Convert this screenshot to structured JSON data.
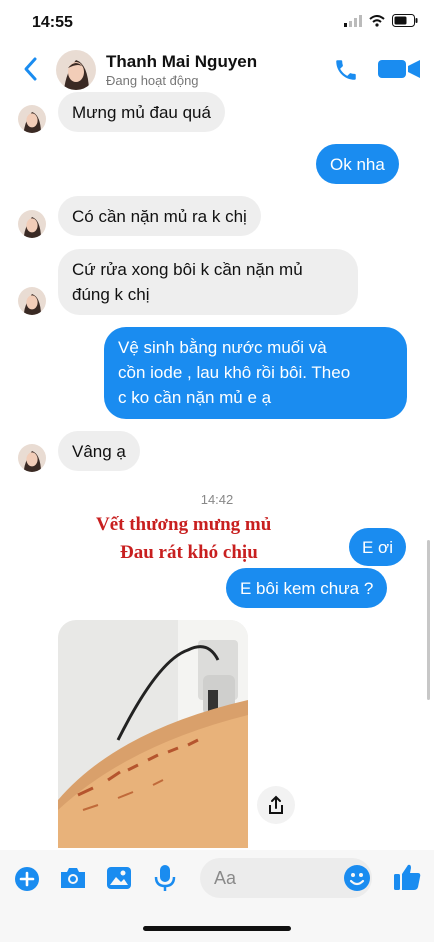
{
  "status_bar": {
    "time": "14:55"
  },
  "header": {
    "contact_name": "Thanh Mai Nguyen",
    "presence": "Đang hoạt động",
    "back_icon": "chevron-left-icon",
    "call_icon": "phone-icon",
    "video_icon": "video-camera-icon"
  },
  "messages": [
    {
      "from": "contact",
      "text": "Mưng mủ đau quá"
    },
    {
      "from": "me",
      "text": "Ok nha"
    },
    {
      "from": "contact",
      "text": "Có cần nặn mủ ra k chị"
    },
    {
      "from": "contact",
      "lines": [
        "Cứ rửa xong bôi k cần nặn mủ",
        "đúng k chị"
      ]
    },
    {
      "from": "me",
      "lines": [
        "Vệ sinh bằng nước muối và",
        "cồn iode , lau khô rồi bôi. Theo",
        "c ko cần nặn mủ e ạ"
      ]
    },
    {
      "from": "contact",
      "text": "Vâng ạ"
    },
    {
      "from": "me",
      "text": "E ơi"
    },
    {
      "from": "me",
      "text": "E bôi kem chưa ?"
    }
  ],
  "time_separator": "14:42",
  "overlay_caption": {
    "line1": "Vết thương mưng mủ",
    "line2": "Đau rát khó chịu"
  },
  "composer": {
    "placeholder": "Aa",
    "icons": [
      "plus-icon",
      "camera-icon",
      "image-icon",
      "microphone-icon",
      "emoji-icon",
      "thumbs-up-icon"
    ]
  },
  "colors": {
    "accent": "#1a8cf0",
    "incoming_bubble": "#eeeeee",
    "caption_red": "#c81f1f"
  }
}
